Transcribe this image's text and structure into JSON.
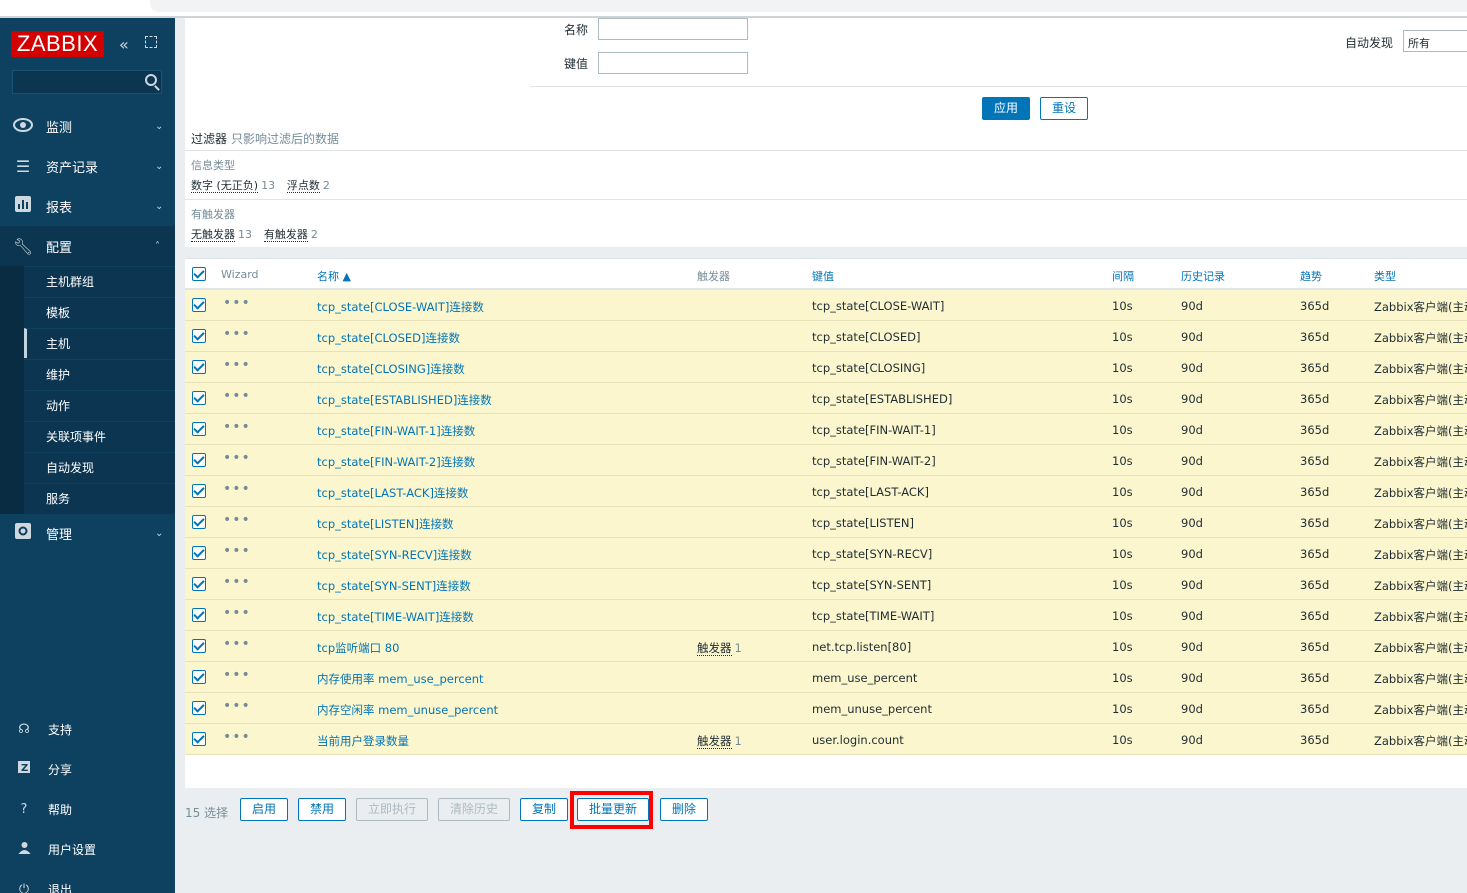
{
  "sidebar": {
    "logo": "ZABBIX",
    "menu": [
      {
        "label": "监测",
        "icon": "eye-icon"
      },
      {
        "label": "资产记录",
        "icon": "list-icon"
      },
      {
        "label": "报表",
        "icon": "chart-icon"
      },
      {
        "label": "配置",
        "icon": "wrench-icon"
      },
      {
        "label": "管理",
        "icon": "gear-icon"
      }
    ],
    "config_sub": [
      "主机群组",
      "模板",
      "主机",
      "维护",
      "动作",
      "关联项事件",
      "自动发现",
      "服务"
    ],
    "bottom": [
      {
        "label": "支持",
        "icon": "headset-icon"
      },
      {
        "label": "分享",
        "icon": "share-icon"
      },
      {
        "label": "帮助",
        "icon": "help-icon"
      },
      {
        "label": "用户设置",
        "icon": "user-icon"
      },
      {
        "label": "退出",
        "icon": "power-icon"
      }
    ]
  },
  "filter": {
    "name_label": "名称",
    "key_label": "键值",
    "discovery_label": "自动发现",
    "discovery_value": "所有",
    "apply": "应用",
    "reset": "重设",
    "bar_title": "过滤器",
    "bar_note": "只影响过滤后的数据",
    "info_type_head": "信息类型",
    "info_types": [
      {
        "label": "数字 (无正负)",
        "count": "13"
      },
      {
        "label": "浮点数",
        "count": "2"
      }
    ],
    "trigger_head": "有触发器",
    "trigger_opts": [
      {
        "label": "无触发器",
        "count": "13"
      },
      {
        "label": "有触发器",
        "count": "2"
      }
    ]
  },
  "table": {
    "headers": {
      "wizard": "Wizard",
      "name": "名称 ▲",
      "triggers": "触发器",
      "key": "键值",
      "interval": "间隔",
      "history": "历史记录",
      "trends": "趋势",
      "type": "类型"
    },
    "rows": [
      {
        "name": "tcp_state[CLOSE-WAIT]连接数",
        "trig": "",
        "trig_cnt": "",
        "key": "tcp_state[CLOSE-WAIT]",
        "interval": "10s",
        "history": "90d",
        "trends": "365d",
        "type": "Zabbix客户端(主动式)"
      },
      {
        "name": "tcp_state[CLOSED]连接数",
        "trig": "",
        "trig_cnt": "",
        "key": "tcp_state[CLOSED]",
        "interval": "10s",
        "history": "90d",
        "trends": "365d",
        "type": "Zabbix客户端(主动式)"
      },
      {
        "name": "tcp_state[CLOSING]连接数",
        "trig": "",
        "trig_cnt": "",
        "key": "tcp_state[CLOSING]",
        "interval": "10s",
        "history": "90d",
        "trends": "365d",
        "type": "Zabbix客户端(主动式)"
      },
      {
        "name": "tcp_state[ESTABLISHED]连接数",
        "trig": "",
        "trig_cnt": "",
        "key": "tcp_state[ESTABLISHED]",
        "interval": "10s",
        "history": "90d",
        "trends": "365d",
        "type": "Zabbix客户端(主动式)"
      },
      {
        "name": "tcp_state[FIN-WAIT-1]连接数",
        "trig": "",
        "trig_cnt": "",
        "key": "tcp_state[FIN-WAIT-1]",
        "interval": "10s",
        "history": "90d",
        "trends": "365d",
        "type": "Zabbix客户端(主动式)"
      },
      {
        "name": "tcp_state[FIN-WAIT-2]连接数",
        "trig": "",
        "trig_cnt": "",
        "key": "tcp_state[FIN-WAIT-2]",
        "interval": "10s",
        "history": "90d",
        "trends": "365d",
        "type": "Zabbix客户端(主动式)"
      },
      {
        "name": "tcp_state[LAST-ACK]连接数",
        "trig": "",
        "trig_cnt": "",
        "key": "tcp_state[LAST-ACK]",
        "interval": "10s",
        "history": "90d",
        "trends": "365d",
        "type": "Zabbix客户端(主动式)"
      },
      {
        "name": "tcp_state[LISTEN]连接数",
        "trig": "",
        "trig_cnt": "",
        "key": "tcp_state[LISTEN]",
        "interval": "10s",
        "history": "90d",
        "trends": "365d",
        "type": "Zabbix客户端(主动式)"
      },
      {
        "name": "tcp_state[SYN-RECV]连接数",
        "trig": "",
        "trig_cnt": "",
        "key": "tcp_state[SYN-RECV]",
        "interval": "10s",
        "history": "90d",
        "trends": "365d",
        "type": "Zabbix客户端(主动式)"
      },
      {
        "name": "tcp_state[SYN-SENT]连接数",
        "trig": "",
        "trig_cnt": "",
        "key": "tcp_state[SYN-SENT]",
        "interval": "10s",
        "history": "90d",
        "trends": "365d",
        "type": "Zabbix客户端(主动式)"
      },
      {
        "name": "tcp_state[TIME-WAIT]连接数",
        "trig": "",
        "trig_cnt": "",
        "key": "tcp_state[TIME-WAIT]",
        "interval": "10s",
        "history": "90d",
        "trends": "365d",
        "type": "Zabbix客户端(主动式)"
      },
      {
        "name": "tcp监听端口 80",
        "trig": "触发器",
        "trig_cnt": "1",
        "key": "net.tcp.listen[80]",
        "interval": "10s",
        "history": "90d",
        "trends": "365d",
        "type": "Zabbix客户端(主动式)"
      },
      {
        "name": "内存使用率 mem_use_percent",
        "trig": "",
        "trig_cnt": "",
        "key": "mem_use_percent",
        "interval": "10s",
        "history": "90d",
        "trends": "365d",
        "type": "Zabbix客户端(主动式)"
      },
      {
        "name": "内存空闲率 mem_unuse_percent",
        "trig": "",
        "trig_cnt": "",
        "key": "mem_unuse_percent",
        "interval": "10s",
        "history": "90d",
        "trends": "365d",
        "type": "Zabbix客户端(主动式)"
      },
      {
        "name": "当前用户登录数量",
        "trig": "触发器",
        "trig_cnt": "1",
        "key": "user.login.count",
        "interval": "10s",
        "history": "90d",
        "trends": "365d",
        "type": "Zabbix客户端(主动式)"
      }
    ]
  },
  "actions": {
    "selected": "15 选择",
    "enable": "启用",
    "disable": "禁用",
    "execute_now": "立即执行",
    "clear_history": "清除历史",
    "copy": "复制",
    "mass_update": "批量更新",
    "delete": "删除"
  },
  "colors": {
    "sidebar": "#0e405f",
    "accent": "#0275b8",
    "row_highlight": "#fbf6cd",
    "annotation": "#ff0000"
  }
}
